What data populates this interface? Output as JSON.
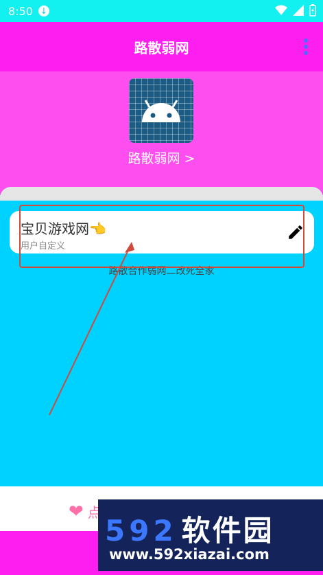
{
  "status": {
    "time": "8:50"
  },
  "appbar": {
    "title": "路散弱网"
  },
  "header": {
    "app_name": "路散弱网 >"
  },
  "card": {
    "title": "宝贝游戏网👈",
    "subtitle": "用户自定义"
  },
  "hint": "路散合作弱网二改死全家",
  "bottom": {
    "like_label": "点"
  },
  "watermark": {
    "brand": "592",
    "brand_cn": "软件园",
    "url": "www.592xiazai.com"
  },
  "colors": {
    "appbar": "#ff1ef0",
    "header": "#ff4ef0",
    "content": "#00d2ff",
    "annotation": "#d24a3b"
  }
}
